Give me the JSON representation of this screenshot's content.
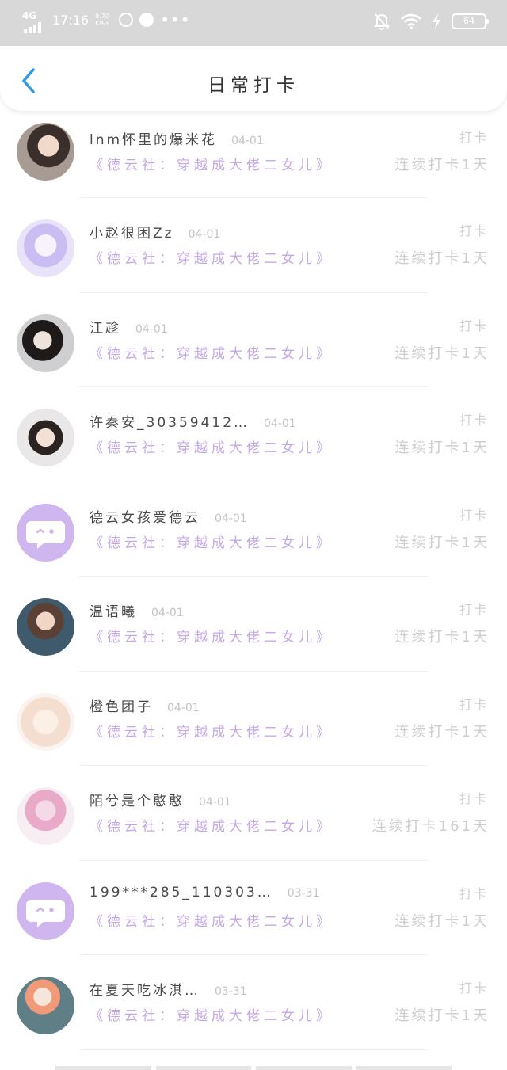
{
  "status_bar": {
    "network": "4G",
    "time": "17:16",
    "speed": "8.70 KB/s",
    "icons": [
      "signal-icon",
      "netease-icon",
      "music-icon",
      "more-dots-icon",
      "mute-bell-icon",
      "wifi-icon",
      "charging-icon",
      "battery-icon"
    ],
    "battery": "64"
  },
  "header": {
    "back_icon": "chevron-left-icon",
    "title": "日常打卡",
    "accent": "#2f9be6"
  },
  "colors": {
    "book_purple": "#c5a8e6",
    "gray_text": "#cdcdcd",
    "default_avatar": "#cfb6ef"
  },
  "rows": [
    {
      "name": "lnm怀里的爆米花",
      "date": "04-01",
      "book": "《德云社：穿越成大佬二女儿》",
      "checkin": "打卡",
      "streak": "连续打卡1天",
      "avatar": "photo-avatar"
    },
    {
      "name": "小赵很困Zz",
      "date": "04-01",
      "book": "《德云社：穿越成大佬二女儿》",
      "checkin": "打卡",
      "streak": "连续打卡1天",
      "avatar": "anime-avatar"
    },
    {
      "name": "江趁",
      "date": "04-01",
      "book": "《德云社：穿越成大佬二女儿》",
      "checkin": "打卡",
      "streak": "连续打卡1天",
      "avatar": "photo-avatar"
    },
    {
      "name": "许秦安_30359412…",
      "date": "04-01",
      "book": "《德云社：穿越成大佬二女儿》",
      "checkin": "打卡",
      "streak": "连续打卡1天",
      "avatar": "photo-avatar"
    },
    {
      "name": "德云女孩爱德云",
      "date": "04-01",
      "book": "《德云社：穿越成大佬二女儿》",
      "checkin": "打卡",
      "streak": "连续打卡1天",
      "avatar": "default-chat-avatar"
    },
    {
      "name": "温语曦",
      "date": "04-01",
      "book": "《德云社：穿越成大佬二女儿》",
      "checkin": "打卡",
      "streak": "连续打卡1天",
      "avatar": "anime-avatar"
    },
    {
      "name": "橙色团子",
      "date": "04-01",
      "book": "《德云社：穿越成大佬二女儿》",
      "checkin": "打卡",
      "streak": "连续打卡1天",
      "avatar": "pale-avatar"
    },
    {
      "name": "陌兮是个憨憨",
      "date": "04-01",
      "book": "《德云社：穿越成大佬二女儿》",
      "checkin": "打卡",
      "streak": "连续打卡161天",
      "avatar": "anime-avatar"
    },
    {
      "name": "199***285_110303…",
      "date": "03-31",
      "book": "《德云社：穿越成大佬二女儿》",
      "checkin": "打卡",
      "streak": "连续打卡1天",
      "avatar": "default-chat-avatar"
    },
    {
      "name": "在夏天吃冰淇…",
      "date": "03-31",
      "book": "《德云社：穿越成大佬二女儿》",
      "checkin": "打卡",
      "streak": "连续打卡1天",
      "avatar": "photo-avatar"
    }
  ]
}
